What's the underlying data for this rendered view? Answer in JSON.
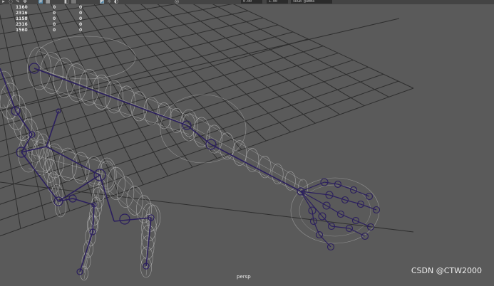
{
  "toolbar": {
    "icons": [
      "select-tool-icon",
      "lasso-icon",
      "paint-select-icon",
      "move-icon",
      "grid-toggle-icon",
      "display-mode-icon",
      "camera-icon",
      "bookmark-icon",
      "xray-icon",
      "lighting-icon",
      "shadow-icon",
      "isolate-icon"
    ],
    "exposure_value": "0.00",
    "gamma_value": "1.00",
    "color_space": "sRGB gamma"
  },
  "hud": {
    "rows": [
      [
        "1160",
        "0",
        "0"
      ],
      [
        "2316",
        "0",
        "0"
      ],
      [
        "1158",
        "0",
        "0"
      ],
      [
        "2316",
        "0",
        "0"
      ],
      [
        "1560",
        "0",
        "0"
      ]
    ]
  },
  "viewport": {
    "camera": "persp",
    "background_color": "#5a5a5a",
    "grid_color": "#2e2e2e",
    "wireframe_color": "#bdbdbd",
    "joint_color": "#2b1f5e"
  },
  "watermark": "CSDN @CTW2000"
}
